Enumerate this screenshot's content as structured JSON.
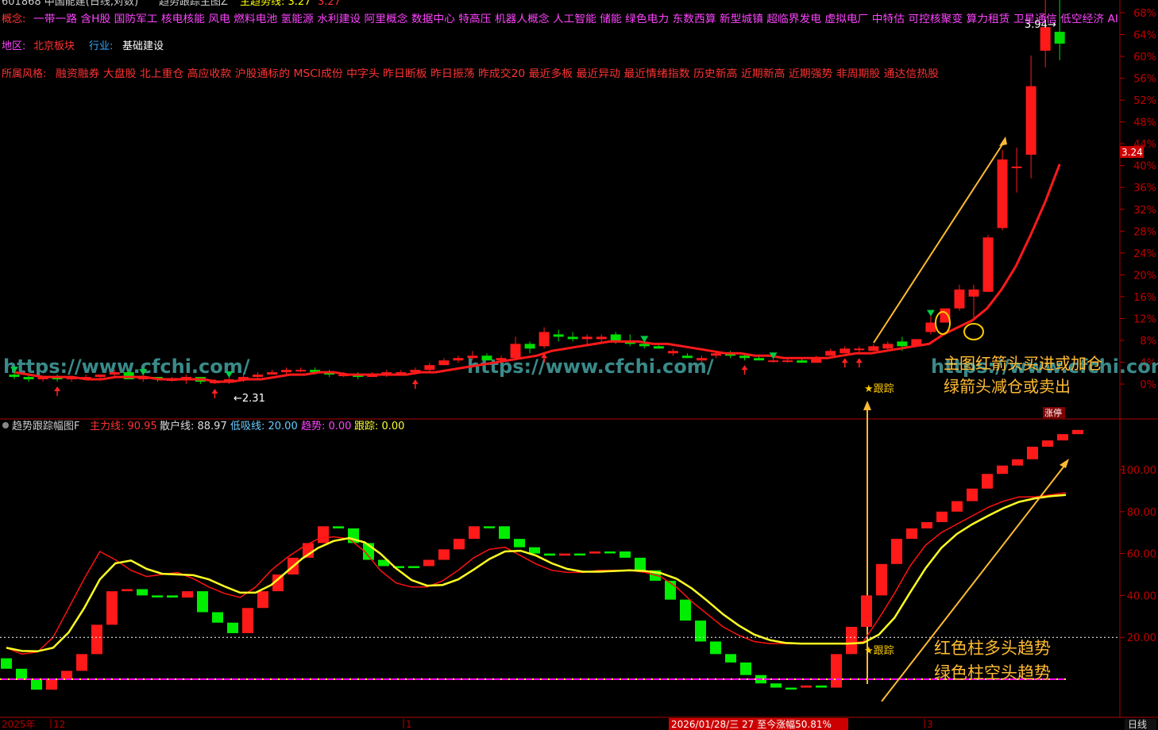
{
  "header": {
    "stock_title": "601868 中国能建(日线,对数)",
    "indicator_title": "趋势跟踪主图Z",
    "main_trend_label": "主趋势线: 3.27",
    "extra_value": "3.27"
  },
  "info": {
    "concepts_label": "概念:",
    "concepts": "一带一路 含H股 国防军工 核电核能 风电 燃料电池 氢能源 水利建设 阿里概念 数据中心 特高压 机器人概念 人工智能 储能 绿色电力 东数西算 新型城镇 超临界发电 虚拟电厂 中特估 可控核聚变 算力租赁 卫星通信 低空经济 AI",
    "region_label": "地区:",
    "region": "北京板块",
    "industry_label": "行业:",
    "industry": "基础建设",
    "style_label": "所属风格:",
    "style": "融资融券 大盘股 北上重仓 高应收款 沪股通标的 MSCI成份 中字头 昨日断板 昨日振荡 昨成交20 最近多板 最近异动 最近情绪指数 历史新高 近期新高 近期强势 非周期股 通达信热股"
  },
  "watermark": "https://www.cfchi.com/",
  "annotations": {
    "main_note_line1": "主图红箭头买进或加仓",
    "main_note_line2": "绿箭头减仓或卖出",
    "sub_note_line1": "红色柱多头趋势",
    "sub_note_line2": "绿色柱空头趋势",
    "track_label": "★跟踪",
    "low_label": "←2.31",
    "high_label": "3.94→",
    "limit_up": "涨停"
  },
  "price_tag": "3.24",
  "sub_header": {
    "title": "趋势跟踪幅图F",
    "main_force": "主力线: 90.95",
    "retail": "散户线: 88.97",
    "low_buy": "低吸线: 20.00",
    "trend": "趋势: 0.00",
    "track": "跟踪: 0.00"
  },
  "bottom_bar": {
    "year": "2025年",
    "m12": "12",
    "m1": "1",
    "date_info": "2026/01/28/三 27 至今涨幅50.81%",
    "m3": "3",
    "period": "日线"
  },
  "colors": {
    "up": "#ff0000",
    "down": "#00ee00",
    "yellow": "#ffff00",
    "magenta": "#ff00ff",
    "axis": "#b00000",
    "orange": "#ffaa33"
  },
  "chart_data": [
    {
      "type": "candlestick",
      "scale": "log",
      "y_axis_percent_ticks": [
        "68%",
        "64%",
        "60%",
        "56%",
        "52%",
        "48%",
        "44%",
        "40%",
        "36%",
        "32%",
        "28%",
        "24%",
        "20%",
        "16%",
        "12%",
        "8%",
        "4%",
        "0%"
      ],
      "y_axis_percent_values": [
        68,
        64,
        60,
        56,
        52,
        48,
        44,
        40,
        36,
        32,
        28,
        24,
        20,
        16,
        12,
        8,
        4,
        0
      ],
      "min_label": 2.31,
      "max_label": 3.94,
      "last_price": 3.24,
      "candles": [
        {
          "o": 2.35,
          "h": 2.36,
          "l": 2.33,
          "c": 2.34
        },
        {
          "o": 2.34,
          "h": 2.35,
          "l": 2.32,
          "c": 2.33
        },
        {
          "o": 2.33,
          "h": 2.34,
          "l": 2.32,
          "c": 2.34
        },
        {
          "o": 2.34,
          "h": 2.35,
          "l": 2.32,
          "c": 2.33
        },
        {
          "o": 2.33,
          "h": 2.34,
          "l": 2.32,
          "c": 2.34
        },
        {
          "o": 2.34,
          "h": 2.35,
          "l": 2.33,
          "c": 2.34
        },
        {
          "o": 2.34,
          "h": 2.35,
          "l": 2.33,
          "c": 2.35
        },
        {
          "o": 2.35,
          "h": 2.37,
          "l": 2.34,
          "c": 2.36
        },
        {
          "o": 2.36,
          "h": 2.37,
          "l": 2.33,
          "c": 2.33
        },
        {
          "o": 2.33,
          "h": 2.35,
          "l": 2.32,
          "c": 2.34
        },
        {
          "o": 2.34,
          "h": 2.34,
          "l": 2.32,
          "c": 2.33
        },
        {
          "o": 2.33,
          "h": 2.34,
          "l": 2.32,
          "c": 2.33
        },
        {
          "o": 2.33,
          "h": 2.35,
          "l": 2.31,
          "c": 2.34
        },
        {
          "o": 2.34,
          "h": 2.34,
          "l": 2.31,
          "c": 2.32
        },
        {
          "o": 2.32,
          "h": 2.33,
          "l": 2.31,
          "c": 2.32
        },
        {
          "o": 2.32,
          "h": 2.34,
          "l": 2.31,
          "c": 2.33
        },
        {
          "o": 2.33,
          "h": 2.35,
          "l": 2.32,
          "c": 2.34
        },
        {
          "o": 2.34,
          "h": 2.36,
          "l": 2.33,
          "c": 2.35
        },
        {
          "o": 2.35,
          "h": 2.37,
          "l": 2.35,
          "c": 2.36
        },
        {
          "o": 2.36,
          "h": 2.38,
          "l": 2.35,
          "c": 2.37
        },
        {
          "o": 2.37,
          "h": 2.38,
          "l": 2.36,
          "c": 2.37
        },
        {
          "o": 2.37,
          "h": 2.38,
          "l": 2.35,
          "c": 2.36
        },
        {
          "o": 2.36,
          "h": 2.37,
          "l": 2.34,
          "c": 2.35
        },
        {
          "o": 2.35,
          "h": 2.36,
          "l": 2.34,
          "c": 2.35
        },
        {
          "o": 2.35,
          "h": 2.36,
          "l": 2.33,
          "c": 2.34
        },
        {
          "o": 2.34,
          "h": 2.36,
          "l": 2.34,
          "c": 2.35
        },
        {
          "o": 2.35,
          "h": 2.37,
          "l": 2.34,
          "c": 2.36
        },
        {
          "o": 2.36,
          "h": 2.37,
          "l": 2.35,
          "c": 2.36
        },
        {
          "o": 2.36,
          "h": 2.38,
          "l": 2.35,
          "c": 2.37
        },
        {
          "o": 2.37,
          "h": 2.4,
          "l": 2.36,
          "c": 2.39
        },
        {
          "o": 2.39,
          "h": 2.42,
          "l": 2.39,
          "c": 2.41
        },
        {
          "o": 2.41,
          "h": 2.43,
          "l": 2.4,
          "c": 2.42
        },
        {
          "o": 2.42,
          "h": 2.45,
          "l": 2.41,
          "c": 2.43
        },
        {
          "o": 2.43,
          "h": 2.44,
          "l": 2.41,
          "c": 2.41
        },
        {
          "o": 2.41,
          "h": 2.43,
          "l": 2.4,
          "c": 2.42
        },
        {
          "o": 2.42,
          "h": 2.51,
          "l": 2.41,
          "c": 2.48
        },
        {
          "o": 2.48,
          "h": 2.49,
          "l": 2.44,
          "c": 2.46
        },
        {
          "o": 2.47,
          "h": 2.55,
          "l": 2.46,
          "c": 2.53
        },
        {
          "o": 2.52,
          "h": 2.54,
          "l": 2.49,
          "c": 2.51
        },
        {
          "o": 2.51,
          "h": 2.53,
          "l": 2.49,
          "c": 2.5
        },
        {
          "o": 2.5,
          "h": 2.52,
          "l": 2.48,
          "c": 2.51
        },
        {
          "o": 2.5,
          "h": 2.52,
          "l": 2.48,
          "c": 2.51
        },
        {
          "o": 2.52,
          "h": 2.53,
          "l": 2.48,
          "c": 2.49
        },
        {
          "o": 2.49,
          "h": 2.52,
          "l": 2.47,
          "c": 2.48
        },
        {
          "o": 2.48,
          "h": 2.49,
          "l": 2.46,
          "c": 2.47
        },
        {
          "o": 2.47,
          "h": 2.48,
          "l": 2.46,
          "c": 2.46
        },
        {
          "o": 2.44,
          "h": 2.46,
          "l": 2.43,
          "c": 2.45
        },
        {
          "o": 2.43,
          "h": 2.44,
          "l": 2.42,
          "c": 2.42
        },
        {
          "o": 2.41,
          "h": 2.43,
          "l": 2.4,
          "c": 2.42
        },
        {
          "o": 2.43,
          "h": 2.45,
          "l": 2.42,
          "c": 2.44
        },
        {
          "o": 2.44,
          "h": 2.45,
          "l": 2.42,
          "c": 2.43
        },
        {
          "o": 2.43,
          "h": 2.44,
          "l": 2.41,
          "c": 2.42
        },
        {
          "o": 2.42,
          "h": 2.43,
          "l": 2.41,
          "c": 2.41
        },
        {
          "o": 2.41,
          "h": 2.42,
          "l": 2.4,
          "c": 2.41
        },
        {
          "o": 2.41,
          "h": 2.42,
          "l": 2.4,
          "c": 2.41
        },
        {
          "o": 2.41,
          "h": 2.42,
          "l": 2.4,
          "c": 2.4
        },
        {
          "o": 2.4,
          "h": 2.43,
          "l": 2.4,
          "c": 2.42
        },
        {
          "o": 2.43,
          "h": 2.46,
          "l": 2.43,
          "c": 2.45
        },
        {
          "o": 2.44,
          "h": 2.47,
          "l": 2.44,
          "c": 2.46
        },
        {
          "o": 2.46,
          "h": 2.47,
          "l": 2.44,
          "c": 2.46
        },
        {
          "o": 2.45,
          "h": 2.48,
          "l": 2.45,
          "c": 2.47
        },
        {
          "o": 2.46,
          "h": 2.49,
          "l": 2.45,
          "c": 2.48
        },
        {
          "o": 2.49,
          "h": 2.51,
          "l": 2.45,
          "c": 2.47
        },
        {
          "o": 2.47,
          "h": 2.5,
          "l": 2.47,
          "c": 2.5
        },
        {
          "o": 2.53,
          "h": 2.6,
          "l": 2.52,
          "c": 2.57
        },
        {
          "o": 2.57,
          "h": 2.63,
          "l": 2.57,
          "c": 2.63
        },
        {
          "o": 2.63,
          "h": 2.73,
          "l": 2.62,
          "c": 2.71
        },
        {
          "o": 2.68,
          "h": 2.73,
          "l": 2.59,
          "c": 2.71
        },
        {
          "o": 2.7,
          "h": 2.94,
          "l": 2.7,
          "c": 2.93
        },
        {
          "o": 2.97,
          "h": 3.3,
          "l": 2.96,
          "c": 3.26
        },
        {
          "o": 3.23,
          "h": 3.31,
          "l": 3.12,
          "c": 3.23
        },
        {
          "o": 3.28,
          "h": 3.7,
          "l": 3.18,
          "c": 3.57
        },
        {
          "o": 3.72,
          "h": 3.94,
          "l": 3.65,
          "c": 3.82
        },
        {
          "o": 3.8,
          "h": 3.94,
          "l": 3.68,
          "c": 3.75
        }
      ],
      "track_line": [
        2.36,
        2.35,
        2.34,
        2.34,
        2.34,
        2.33,
        2.33,
        2.34,
        2.34,
        2.34,
        2.33,
        2.33,
        2.33,
        2.33,
        2.32,
        2.32,
        2.33,
        2.33,
        2.34,
        2.35,
        2.35,
        2.36,
        2.36,
        2.35,
        2.35,
        2.35,
        2.35,
        2.35,
        2.36,
        2.36,
        2.37,
        2.38,
        2.39,
        2.4,
        2.41,
        2.42,
        2.43,
        2.45,
        2.46,
        2.47,
        2.48,
        2.49,
        2.49,
        2.49,
        2.48,
        2.48,
        2.47,
        2.46,
        2.45,
        2.44,
        2.44,
        2.43,
        2.43,
        2.42,
        2.42,
        2.42,
        2.42,
        2.43,
        2.44,
        2.44,
        2.45,
        2.46,
        2.47,
        2.48,
        2.52,
        2.55,
        2.58,
        2.63,
        2.71,
        2.81,
        2.94,
        3.08,
        3.24
      ]
    },
    {
      "type": "indicator",
      "y_ticks": [
        "100.00",
        "80.00",
        "60.00",
        "40.00",
        "20.00"
      ],
      "y_values": [
        100,
        80,
        60,
        40,
        20
      ],
      "low_buy_line": 20.0,
      "trend_line": 0.0,
      "bars": [
        [
          10,
          5
        ],
        [
          5,
          0
        ],
        [
          0,
          -5
        ],
        [
          -5,
          0
        ],
        [
          0,
          4
        ],
        [
          4,
          12
        ],
        [
          12,
          26
        ],
        [
          26,
          42
        ],
        [
          42,
          43
        ],
        [
          43,
          40
        ],
        [
          40,
          40
        ],
        [
          40,
          39
        ],
        [
          39,
          42
        ],
        [
          42,
          32
        ],
        [
          32,
          27
        ],
        [
          27,
          22
        ],
        [
          22,
          34
        ],
        [
          34,
          42
        ],
        [
          42,
          50
        ],
        [
          50,
          58
        ],
        [
          58,
          65
        ],
        [
          65,
          73
        ],
        [
          73,
          72
        ],
        [
          72,
          65
        ],
        [
          65,
          57
        ],
        [
          57,
          54
        ],
        [
          54,
          54
        ],
        [
          54,
          54
        ],
        [
          54,
          57
        ],
        [
          57,
          62
        ],
        [
          62,
          67
        ],
        [
          67,
          73
        ],
        [
          73,
          73
        ],
        [
          73,
          67
        ],
        [
          67,
          63
        ],
        [
          63,
          60
        ],
        [
          60,
          59
        ],
        [
          59,
          60
        ],
        [
          60,
          60
        ],
        [
          60,
          61
        ],
        [
          61,
          61
        ],
        [
          61,
          58
        ],
        [
          58,
          52
        ],
        [
          52,
          47
        ],
        [
          47,
          38
        ],
        [
          38,
          28
        ],
        [
          28,
          18
        ],
        [
          18,
          12
        ],
        [
          12,
          8
        ],
        [
          8,
          2
        ],
        [
          2,
          -2
        ],
        [
          -2,
          -4
        ],
        [
          -4,
          -4
        ],
        [
          -4,
          -3
        ],
        [
          -3,
          -4
        ],
        [
          -4,
          12
        ],
        [
          12,
          25
        ],
        [
          25,
          40
        ],
        [
          40,
          55
        ],
        [
          55,
          67
        ],
        [
          67,
          72
        ],
        [
          72,
          75
        ],
        [
          75,
          80
        ],
        [
          80,
          85
        ],
        [
          85,
          91
        ],
        [
          91,
          98
        ],
        [
          98,
          102
        ],
        [
          102,
          105
        ],
        [
          105,
          111
        ],
        [
          111,
          114
        ],
        [
          114,
          117
        ],
        [
          117,
          119
        ]
      ],
      "retail_line": [
        15,
        12,
        13,
        20,
        34,
        48,
        61,
        57,
        52,
        49,
        50,
        51,
        48,
        44,
        41,
        39,
        44,
        52,
        58,
        63,
        67,
        68,
        67,
        61,
        52,
        46,
        44,
        44,
        47,
        52,
        58,
        62,
        63,
        59,
        55,
        52,
        51,
        51,
        52,
        52,
        52,
        51,
        49,
        44,
        37,
        31,
        25,
        21,
        18,
        17,
        17,
        17,
        17,
        17,
        17,
        18,
        29,
        41,
        54,
        64,
        70,
        74,
        78,
        82,
        85,
        87,
        87,
        88,
        89
      ]
    }
  ]
}
